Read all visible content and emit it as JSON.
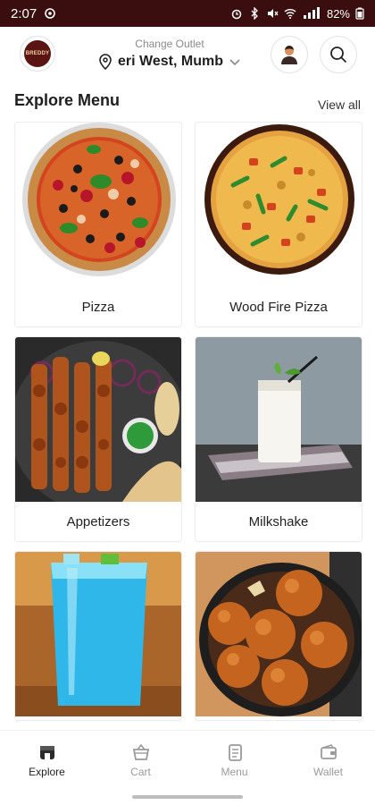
{
  "status_bar": {
    "time": "2:07",
    "battery": "82%"
  },
  "header": {
    "outlet_caption": "Change Outlet",
    "outlet_name": "eri West, Mumb",
    "logo_text": "BREDDY"
  },
  "menu": {
    "title": "Explore Menu",
    "view_all": "View all",
    "categories": [
      {
        "label": "Pizza"
      },
      {
        "label": "Wood Fire Pizza"
      },
      {
        "label": "Appetizers"
      },
      {
        "label": "Milkshake"
      },
      {
        "label": ""
      },
      {
        "label": ""
      }
    ]
  },
  "bottom_nav": [
    {
      "label": "Explore",
      "icon": "store-icon",
      "active": true
    },
    {
      "label": "Cart",
      "icon": "basket-icon",
      "active": false
    },
    {
      "label": "Menu",
      "icon": "menu-book-icon",
      "active": false
    },
    {
      "label": "Wallet",
      "icon": "wallet-icon",
      "active": false
    }
  ],
  "colors": {
    "status_bar": "#3a0e0e",
    "brand": "#5a1512"
  }
}
